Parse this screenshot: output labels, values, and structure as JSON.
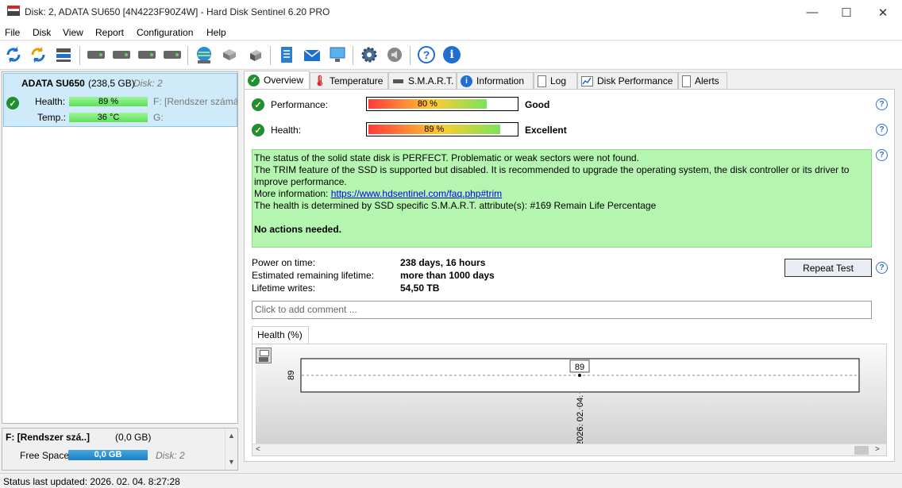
{
  "window": {
    "title": "Disk: 2, ADATA SU650 [4N4223F90Z4W]  -  Hard Disk Sentinel 6.20 PRO",
    "minimize": "—",
    "maximize": "☐",
    "close": "✕"
  },
  "menu": [
    "File",
    "Disk",
    "View",
    "Report",
    "Configuration",
    "Help"
  ],
  "toolbar": {
    "icons": [
      "refresh-icon",
      "refresh-all-icon",
      "disk-list-icon",
      "disk-test-icon",
      "disk-schedule-icon",
      "disk-ok-icon",
      "disk-search-icon",
      "network-icon",
      "drive-icon",
      "drive-alt-icon",
      "report-icon",
      "email-icon",
      "computer-icon",
      "settings-icon",
      "sound-icon",
      "help-icon",
      "info-icon"
    ]
  },
  "disk_list": {
    "name": "ADATA SU650",
    "size": "(238,5 GB)",
    "disk_label": "Disk: 2",
    "health_label": "Health:",
    "health_value": "89 %",
    "health_drive": "F: [Rendszer számára",
    "temp_label": "Temp.:",
    "temp_value": "36 °C",
    "temp_drive": "G:"
  },
  "volume": {
    "name": "F: [Rendszer szá..]",
    "size": "(0,0 GB)",
    "free_label": "Free Space",
    "free_value": "0,0 GB",
    "disk_label": "Disk: 2",
    "scroll_up": "▲",
    "scroll_down": "▼"
  },
  "status_bar": "Status last updated: 2026. 02. 04. 8:27:28",
  "tabs": [
    "Overview",
    "Temperature",
    "S.M.A.R.T.",
    "Information",
    "Log",
    "Disk Performance",
    "Alerts"
  ],
  "overview": {
    "performance_label": "Performance:",
    "performance_value": "80 %",
    "performance_pct": 80,
    "performance_rating": "Good",
    "health_label": "Health:",
    "health_value": "89 %",
    "health_pct": 89,
    "health_rating": "Excellent",
    "status_lines": [
      "The status of the solid state disk is PERFECT. Problematic or weak sectors were not found.",
      "The TRIM feature of the SSD is supported but disabled. It is recommended to upgrade the operating system, the disk controller or its driver to improve performance.",
      "More information: ",
      "The health is determined by SSD specific S.M.A.R.T. attribute(s):  #169 Remain Life Percentage"
    ],
    "link": "https://www.hdsentinel.com/faq.php#trim",
    "action": "No actions needed.",
    "power_on_label": "Power on time:",
    "power_on_value": "238 days, 16 hours",
    "remaining_label": "Estimated remaining lifetime:",
    "remaining_value": "more than 1000 days",
    "writes_label": "Lifetime writes:",
    "writes_value": "54,50 TB",
    "repeat_button": "Repeat Test",
    "comment_placeholder": "Click to add comment ...",
    "help": "?"
  },
  "health_chart": {
    "tab": "Health (%)",
    "y_tick": "89",
    "point_label": "89",
    "x_tick": "2026. 02. 04.",
    "scroll_left": "<",
    "scroll_right": ">"
  },
  "chart_data": {
    "type": "line",
    "x": [
      "2026. 02. 04."
    ],
    "series": [
      {
        "values": [
          89
        ]
      }
    ],
    "title": "Health (%)",
    "ylim": [
      88,
      90
    ],
    "grid": true
  }
}
